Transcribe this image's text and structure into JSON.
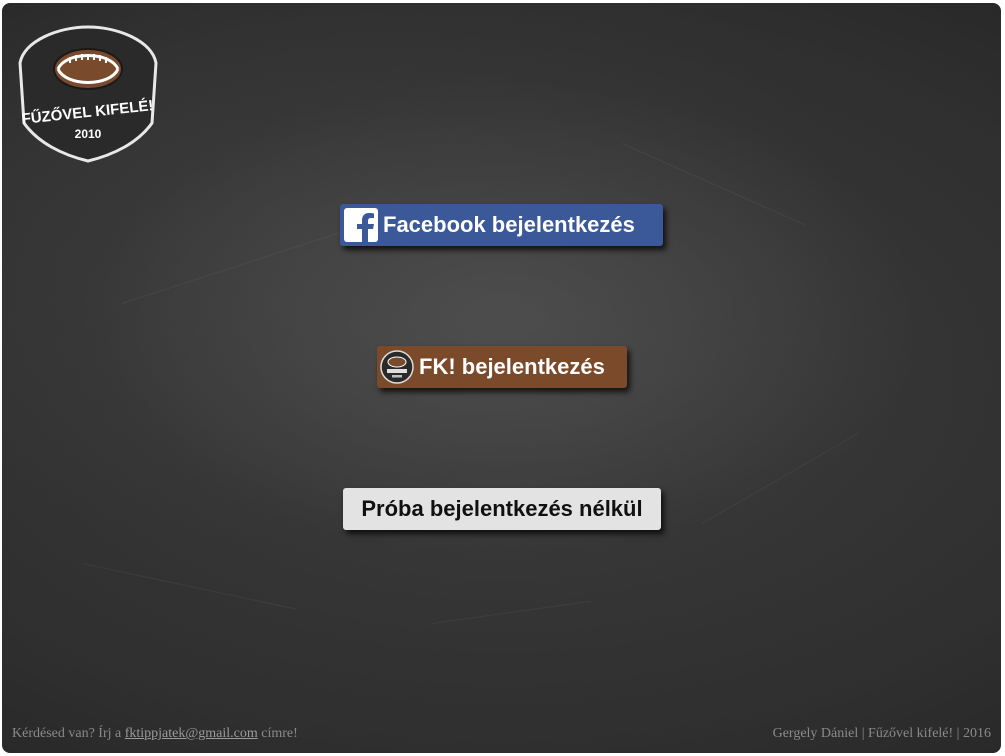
{
  "logo": {
    "line1": "FŰZŐVEL KIFELÉ!",
    "year": "2010"
  },
  "buttons": {
    "facebook_label": "Facebook bejelentkezés",
    "fk_label": "FK! bejelentkezés",
    "trial_label": "Próba bejelentkezés nélkül"
  },
  "footer": {
    "question_prefix": "Kérdésed van? Írj a ",
    "email": "fktippjatek@gmail.com",
    "question_suffix": " címre!",
    "credits": "Gergely Dániel | Fűzővel kifelé! | 2016"
  },
  "colors": {
    "facebook": "#3b5998",
    "fk": "#7b4a2a",
    "trial": "#e3e3e3",
    "background": "#2f2f2f"
  }
}
